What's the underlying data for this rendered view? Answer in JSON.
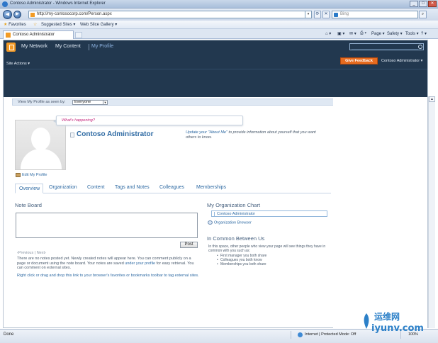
{
  "window": {
    "title": "Contoso Administrator - Windows Internet Explorer",
    "min": "_",
    "max": "□",
    "close": "✕"
  },
  "navbar": {
    "back": "◀",
    "forward": "▶",
    "url": "http://my-contosocorp.com/Person.aspx",
    "dropdown": "▾",
    "refresh": "⟳",
    "stop": "✕",
    "search_placeholder": "Bing",
    "search_button": "⌕"
  },
  "favorites_bar": {
    "favorites": "Favorites",
    "suggested_sites": "Suggested Sites ▾",
    "web_slice_gallery": "Web Slice Gallery ▾"
  },
  "tab": {
    "label": "Contoso Administrator"
  },
  "command_bar": {
    "home": "⌂ ▾",
    "feeds": "▣ ▾",
    "mail": "✉ ▾",
    "print": "⎙ ▾",
    "page": "Page ▾",
    "safety": "Safety ▾",
    "tools": "Tools ▾",
    "help": "? ▾"
  },
  "sharepoint": {
    "nav": {
      "my_network": "My Network",
      "my_content": "My Content",
      "my_profile": "My Profile"
    },
    "site_actions": "Site Actions ▾",
    "give_feedback": "Give Feedback",
    "user_menu": "Contoso Administrator ▾"
  },
  "profile": {
    "view_as_label": "View My Profile as seen by:",
    "view_as_value": "Everyone",
    "whats_happening": "What's happening?",
    "name": "Contoso Administrator",
    "about_link": "Update your \"About Me\"",
    "about_rest": " to provide information about yourself that you want others to know.",
    "edit_my_profile": "Edit My Profile"
  },
  "tabs": [
    "Overview",
    "Organization",
    "Content",
    "Tags and Notes",
    "Colleagues",
    "Memberships"
  ],
  "note_board": {
    "heading": "Note Board",
    "post": "Post",
    "pager": "‹Previous  |  Next›",
    "no_notes_text": "There are no notes posted yet. Newly created notes will appear here. You can comment publicly on a page or document using the note board. Your notes are saved ",
    "no_notes_link": "under your profile",
    "no_notes_tail": " for easy retrieval. You can comment on external sites.",
    "drag_tip": "Right click or drag and drop this link to your browser's favorites or bookmarks toolbar to tag external sites."
  },
  "org_chart": {
    "heading": "My Organization Chart",
    "person": "Contoso Administrator",
    "browser": "Organization Browser"
  },
  "in_common": {
    "heading": "In Common Between Us",
    "description": "In this space, other people who view your page will see things they have in common with you such as:",
    "items": [
      "First manager you both share",
      "Colleagues you both know",
      "Memberships you both share"
    ]
  },
  "scrollbar": {
    "up": "▲"
  },
  "status": {
    "done": "Done",
    "zone": "Internet | Protected Mode: Off",
    "zoom": "100%"
  },
  "watermark": {
    "line1": "运维网",
    "line2": "iyunv.com"
  },
  "colors": {
    "sp_header": "#22384f",
    "accent": "#2e6aa3",
    "feedback": "#e76b1f",
    "logo": "#f39a26"
  }
}
